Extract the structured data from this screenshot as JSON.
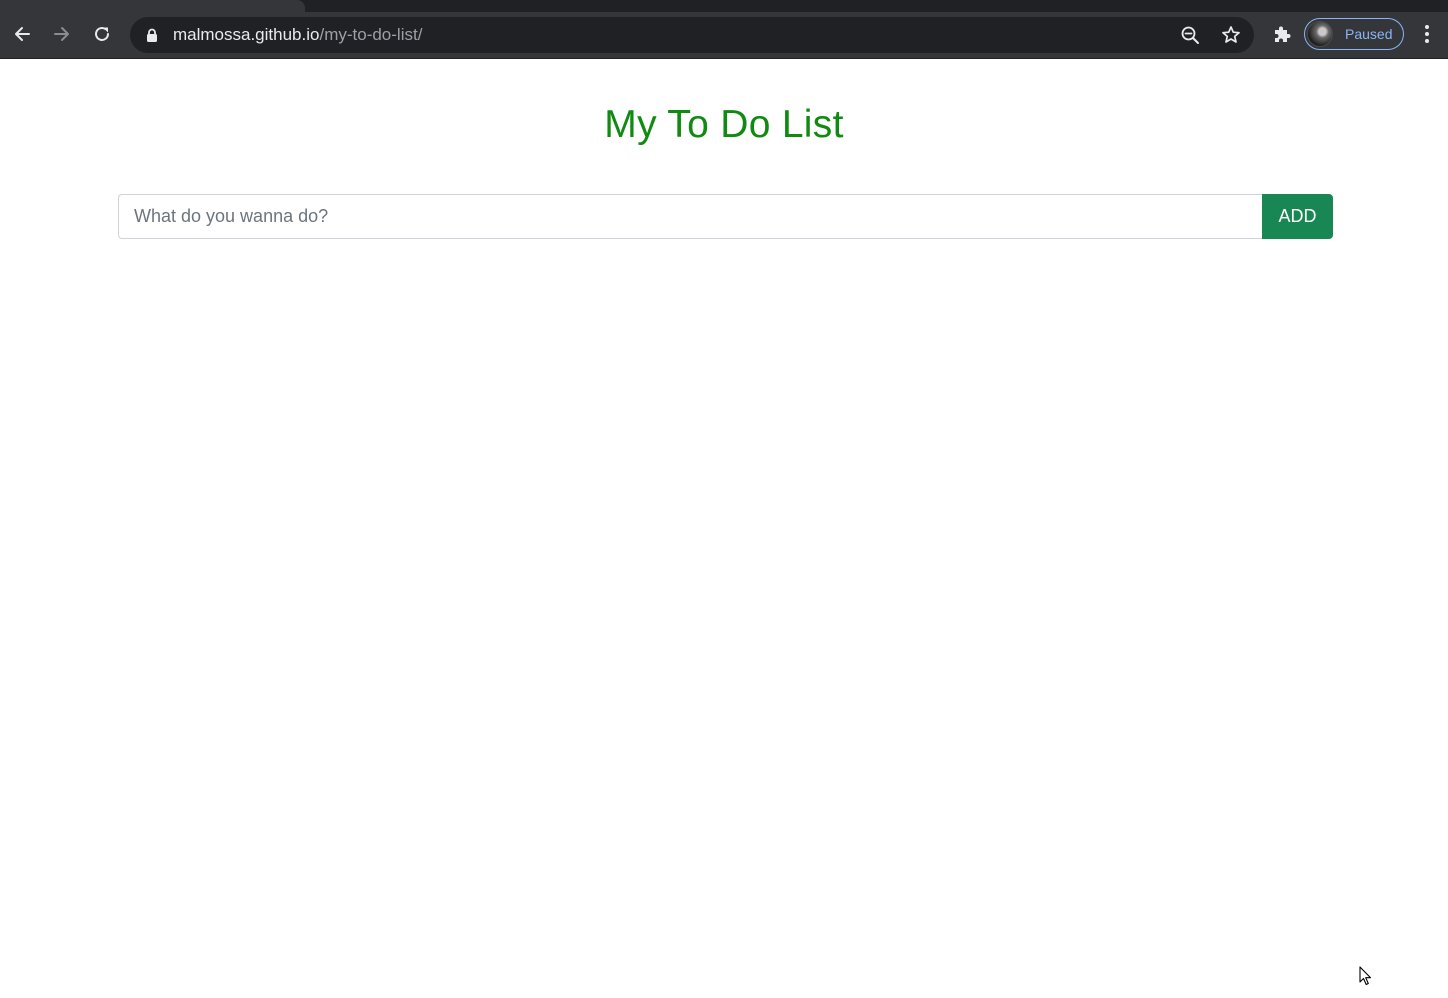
{
  "browser": {
    "url_host": "malmossa.github.io",
    "url_path": "/my-to-do-list/",
    "profile_status": "Paused",
    "accent_color": "#8ab4f8"
  },
  "icons": {
    "back": "arrow-left-icon",
    "forward": "arrow-right-icon",
    "reload": "reload-icon",
    "lock": "lock-icon",
    "zoom": "zoom-out-icon",
    "bookmark": "star-icon",
    "extensions": "puzzle-icon",
    "menu": "kebab-menu-icon"
  },
  "page": {
    "title": "My To Do List",
    "title_color": "#118a11",
    "input_placeholder": "What do you wanna do?",
    "input_value": "",
    "add_label": "ADD",
    "button_color": "#198754"
  }
}
